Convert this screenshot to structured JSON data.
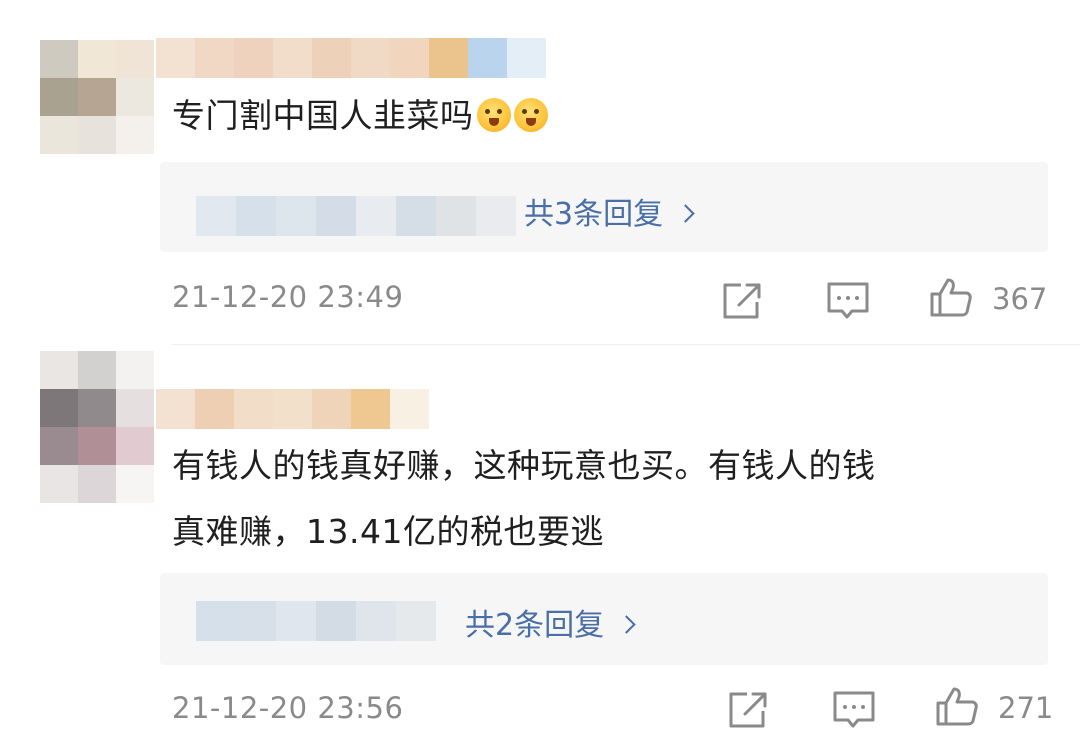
{
  "comments": [
    {
      "text": "专门割中国人韭菜吗",
      "reply_label": "共3条回复",
      "timestamp": "21-12-20 23:49",
      "like_count": "367"
    },
    {
      "text_line1": "有钱人的钱真好赚，这种玩意也买。有钱人的钱",
      "text_line2": "真难赚，13.41亿的税也要逃",
      "reply_label": "共2条回复",
      "timestamp": "21-12-20 23:56",
      "like_count": "271"
    }
  ],
  "icons": {
    "share": "share-icon",
    "comment": "comment-icon",
    "like": "thumbs-up-icon",
    "reply_more": "chevron-right-icon",
    "emoji": "shy-smile-emoji"
  },
  "colors": {
    "link": "#4a6ea8",
    "meta_text": "#8a8a8a",
    "reply_background": "#f6f6f6"
  }
}
